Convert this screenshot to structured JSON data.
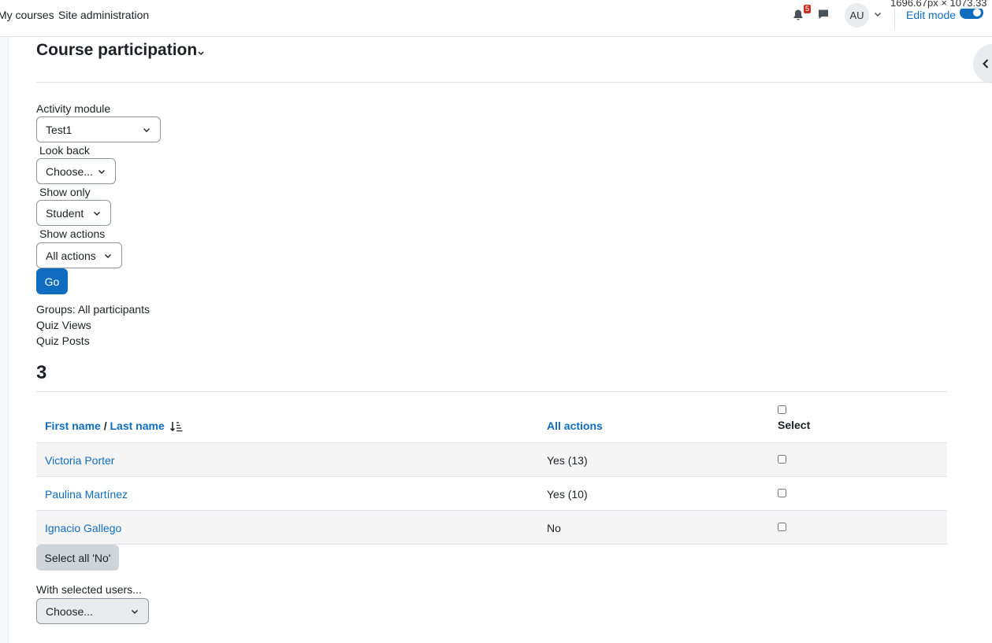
{
  "navbar": {
    "my_courses": "My courses",
    "site_admin": "Site administration",
    "notification_count": "5",
    "avatar_initials": "AU",
    "edit_mode": "Edit mode",
    "dimension_readout": "1696.67px × 1073.33"
  },
  "page": {
    "title": "Course participation"
  },
  "filters": {
    "activity_label": "Activity module",
    "activity_value": "Test1",
    "lookback_label": "Look back",
    "lookback_value": "Choose...",
    "showonly_label": "Show only",
    "showonly_value": "Student",
    "showactions_label": "Show actions",
    "showactions_value": "All actions",
    "go_label": "Go"
  },
  "info": {
    "groups": "Groups: All participants",
    "views": "Quiz Views",
    "posts": "Quiz Posts",
    "count": "3"
  },
  "table": {
    "col_first": "First name",
    "col_sep": " / ",
    "col_last": "Last name",
    "col_actions": "All actions",
    "col_select": "Select",
    "rows": [
      {
        "name": "Victoria Porter",
        "action": "Yes (13)"
      },
      {
        "name": "Paulina Martínez",
        "action": "Yes (10)"
      },
      {
        "name": "Ignacio Gallego",
        "action": "No"
      }
    ]
  },
  "bulk": {
    "select_all_no": "Select all 'No'",
    "with_selected_label": "With selected users...",
    "with_selected_value": "Choose..."
  },
  "colors": {
    "primary": "#0f6cbf",
    "badge": "#ca3120"
  }
}
